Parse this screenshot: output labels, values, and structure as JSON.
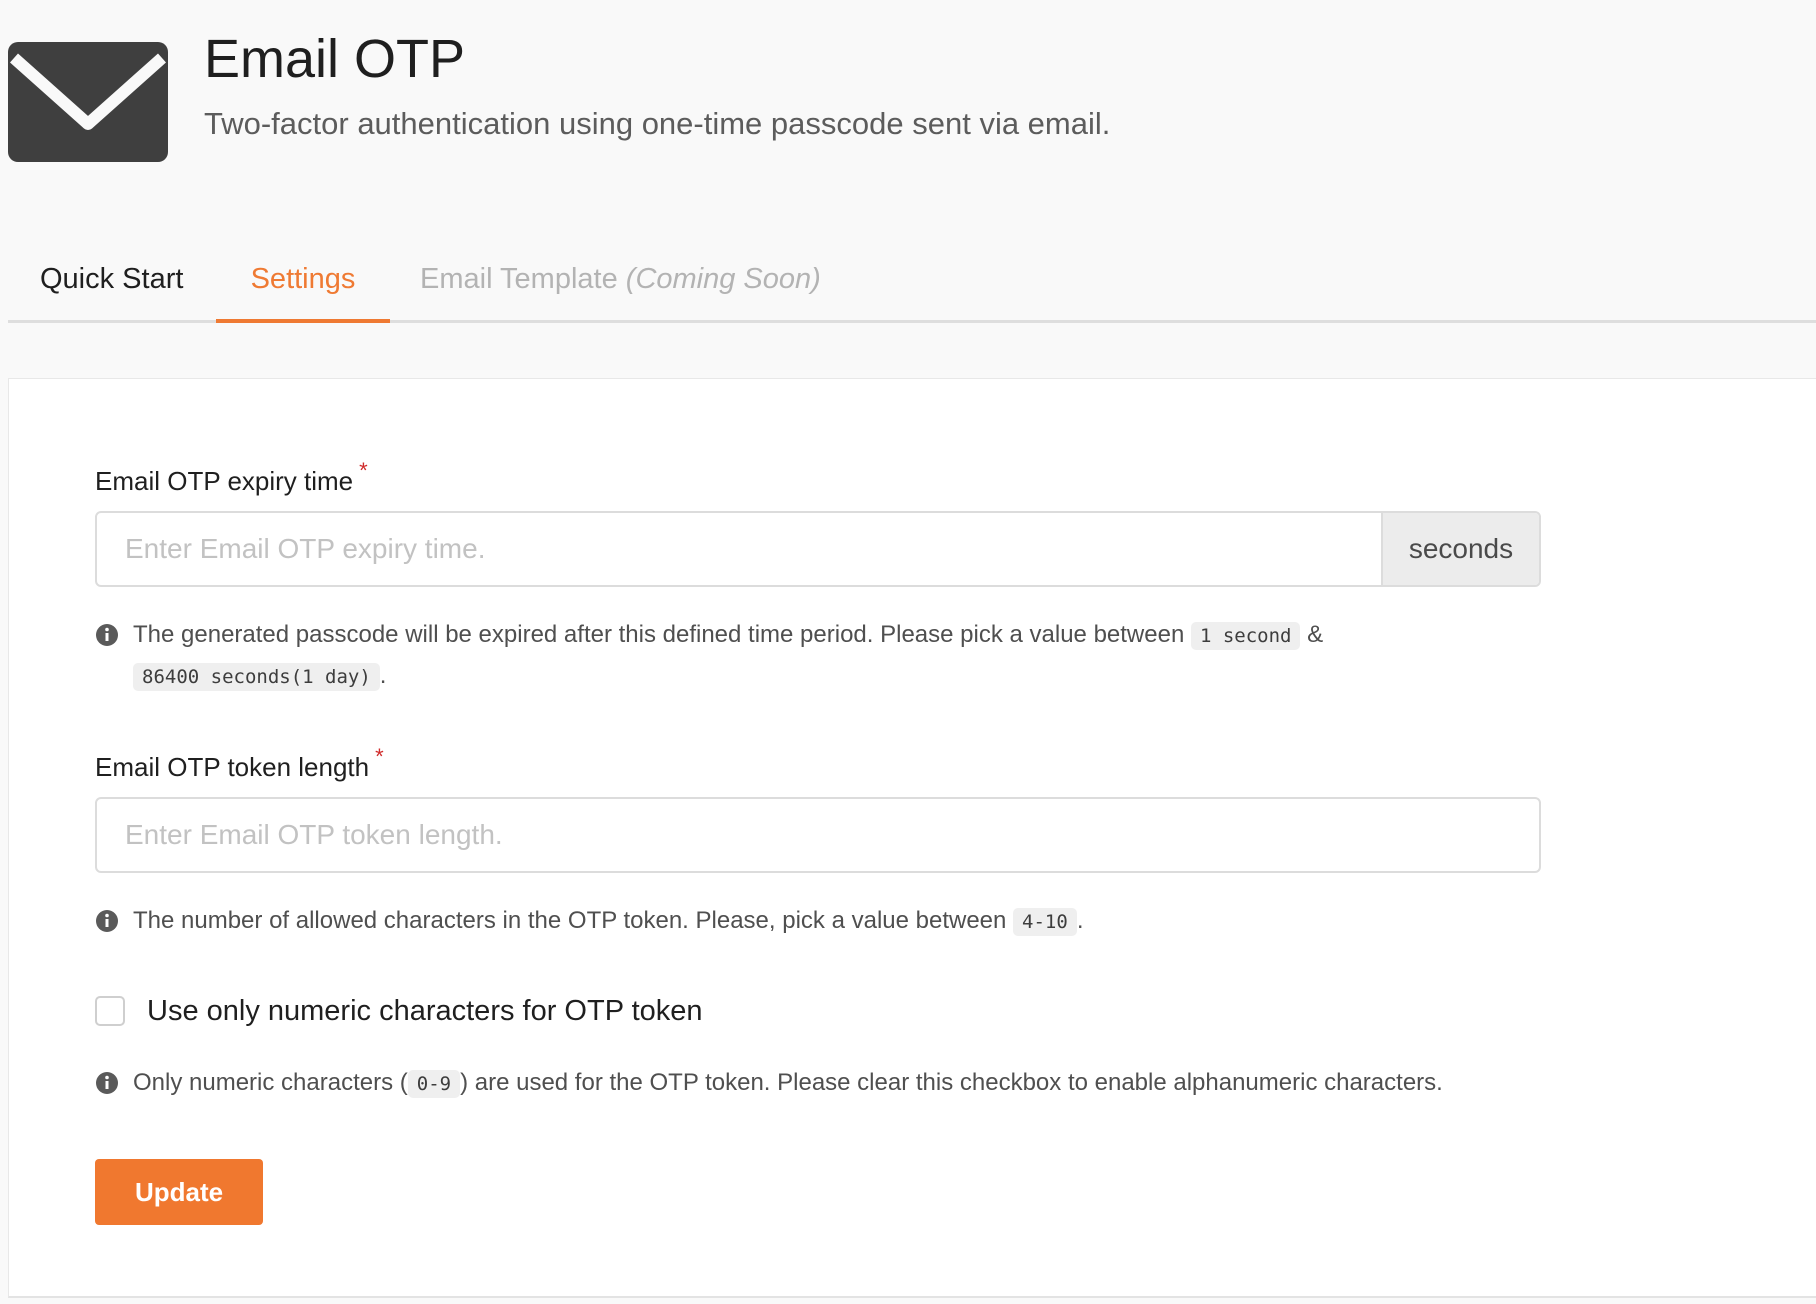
{
  "header": {
    "icon": "mail-icon",
    "title": "Email OTP",
    "subtitle": "Two-factor authentication using one-time passcode sent via email."
  },
  "tabs": [
    {
      "label": "Quick Start",
      "active": false
    },
    {
      "label": "Settings",
      "active": true
    },
    {
      "label": "Email Template",
      "note": "(Coming Soon)",
      "active": false,
      "disabled": true
    }
  ],
  "form": {
    "expiry": {
      "label": "Email OTP expiry time",
      "required_mark": "*",
      "placeholder": "Enter Email OTP expiry time.",
      "value": "",
      "addon": "seconds",
      "hint": {
        "icon": "info-icon",
        "text_before": "The generated passcode will be expired after this defined time period. Please pick a value between ",
        "code_min": "1 second",
        "separator": " & ",
        "code_max": "86400 seconds(1 day)",
        "text_after": "."
      }
    },
    "token_length": {
      "label": "Email OTP token length",
      "required_mark": "*",
      "placeholder": "Enter Email OTP token length.",
      "value": "",
      "hint": {
        "icon": "info-icon",
        "text_before": "The number of allowed characters in the OTP token. Please, pick a value between ",
        "code": "4-10",
        "text_after": "."
      }
    },
    "numeric_only": {
      "label": "Use only numeric characters for OTP token",
      "checked": false,
      "hint": {
        "icon": "info-icon",
        "text_before": "Only numeric characters (",
        "code": "0-9",
        "text_after": ") are used for the OTP token. Please clear this checkbox to enable alphanumeric characters."
      }
    },
    "update_label": "Update"
  },
  "colors": {
    "accent": "#f0782f",
    "active_tab": "#ef7a33",
    "required": "#d02b2b",
    "icon": "#3f3f3f"
  }
}
